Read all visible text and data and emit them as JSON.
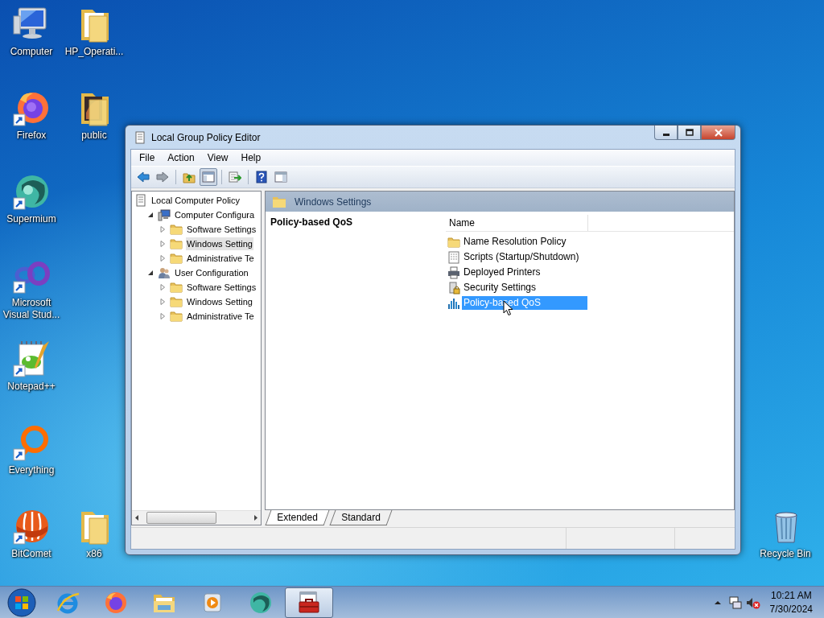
{
  "desktop": {
    "icons": [
      {
        "label": "Computer",
        "kind": "computer",
        "shortcut": false
      },
      {
        "label": "HP_Operati...",
        "kind": "folder",
        "shortcut": false
      },
      {
        "label": "Firefox",
        "kind": "firefox",
        "shortcut": true
      },
      {
        "label": "public",
        "kind": "folder-picture",
        "shortcut": false
      },
      {
        "label": "Supermium",
        "kind": "supermium",
        "shortcut": true
      },
      {
        "label": "Microsoft Visual Stud...",
        "kind": "infinity",
        "shortcut": true
      },
      {
        "label": "Notepad++",
        "kind": "notepad",
        "shortcut": true
      },
      {
        "label": "Everything",
        "kind": "ring",
        "shortcut": true
      },
      {
        "label": "BitComet",
        "kind": "comet",
        "shortcut": true
      },
      {
        "label": "x86",
        "kind": "folder",
        "shortcut": false
      },
      {
        "label": "Recycle Bin",
        "kind": "recycle",
        "shortcut": false
      }
    ]
  },
  "window": {
    "title": "Local Group Policy Editor",
    "controls": [
      {
        "kind": "minimize"
      },
      {
        "kind": "maximize"
      },
      {
        "kind": "close"
      }
    ]
  },
  "menu": [
    "File",
    "Action",
    "View",
    "Help"
  ],
  "toolbar": [
    {
      "kind": "back",
      "pressed": false
    },
    {
      "kind": "forward",
      "pressed": false
    },
    {
      "kind": "separator"
    },
    {
      "kind": "up",
      "pressed": false
    },
    {
      "kind": "tree",
      "pressed": true
    },
    {
      "kind": "separator"
    },
    {
      "kind": "export",
      "pressed": false
    },
    {
      "kind": "separator"
    },
    {
      "kind": "help",
      "pressed": false
    },
    {
      "kind": "pane",
      "pressed": false
    }
  ],
  "tree": [
    {
      "label": "Local Computer Policy",
      "kind": "policy",
      "selected": false,
      "children": [
        {
          "label": "Computer Configura",
          "kind": "computer",
          "expanded": true,
          "selected": false,
          "children": [
            {
              "label": "Software Settings",
              "kind": "folder",
              "expanded": false,
              "selected": false
            },
            {
              "label": "Windows Setting",
              "kind": "folder",
              "expanded": false,
              "selected": true
            },
            {
              "label": "Administrative Te",
              "kind": "folder",
              "expanded": false,
              "selected": false
            }
          ]
        },
        {
          "label": "User Configuration",
          "kind": "user",
          "expanded": true,
          "selected": false,
          "children": [
            {
              "label": "Software Settings",
              "kind": "folder",
              "expanded": false,
              "selected": false
            },
            {
              "label": "Windows Setting",
              "kind": "folder",
              "expanded": false,
              "selected": false
            },
            {
              "label": "Administrative Te",
              "kind": "folder",
              "expanded": false,
              "selected": false
            }
          ]
        }
      ]
    }
  ],
  "details": {
    "header": "Windows Settings",
    "description_title": "Policy-based QoS",
    "columns": [
      "Name"
    ],
    "items": [
      {
        "label": "Name Resolution Policy",
        "kind": "folder",
        "selected": false
      },
      {
        "label": "Scripts (Startup/Shutdown)",
        "kind": "script",
        "selected": false
      },
      {
        "label": "Deployed Printers",
        "kind": "printer",
        "selected": false
      },
      {
        "label": "Security Settings",
        "kind": "security",
        "selected": false
      },
      {
        "label": "Policy-based QoS",
        "kind": "bars",
        "selected": true
      }
    ]
  },
  "view_tabs": [
    {
      "label": "Extended",
      "selected": true
    },
    {
      "label": "Standard",
      "selected": false
    }
  ],
  "taskbar": {
    "buttons": [
      {
        "kind": "start",
        "active": false
      },
      {
        "kind": "ie",
        "active": false
      },
      {
        "kind": "firefox",
        "active": false
      },
      {
        "kind": "explorer",
        "active": false
      },
      {
        "kind": "player",
        "active": false
      },
      {
        "kind": "supermium",
        "active": false
      },
      {
        "kind": "toolbox",
        "active": true
      }
    ],
    "tray": [
      {
        "kind": "arrow"
      },
      {
        "kind": "network"
      },
      {
        "kind": "volume-muted"
      }
    ],
    "time": "10:21 AM",
    "date": "7/30/2024"
  }
}
